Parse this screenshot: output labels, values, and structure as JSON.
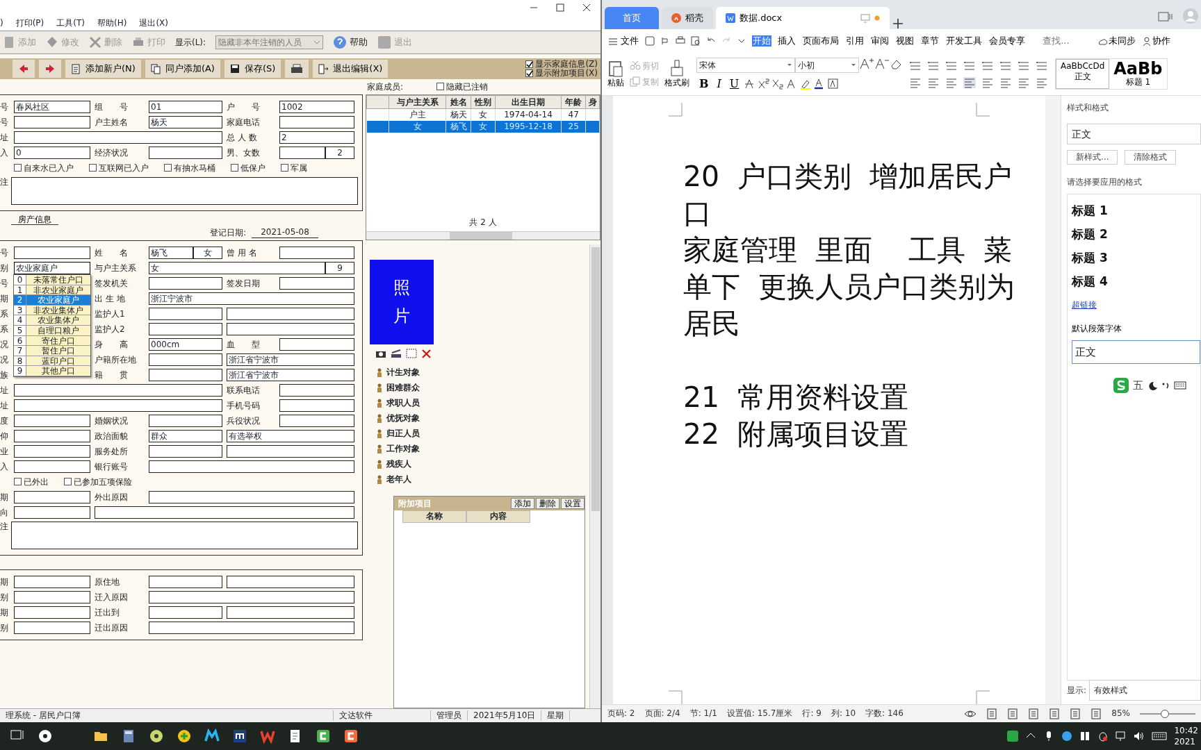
{
  "app": {
    "menu": [
      ")",
      "打印(P)",
      "工具(T)",
      "帮助(H)",
      "退出(X)"
    ],
    "toolbar": [
      {
        "kind": "button",
        "label": "添加",
        "disabled": true
      },
      {
        "kind": "button",
        "label": "修改",
        "disabled": true
      },
      {
        "kind": "button",
        "label": "删除",
        "disabled": true
      },
      {
        "kind": "button",
        "label": "打印",
        "disabled": true
      },
      {
        "kind": "select",
        "label": "显示(L):",
        "value": "隐藏非本年注销的人员",
        "disabled": true
      },
      {
        "kind": "button",
        "label": "帮助",
        "disabled": false
      },
      {
        "kind": "button",
        "label": "退出",
        "disabled": true
      }
    ],
    "edit_buttons": [
      "添加新户(N)",
      "同户添加(A)",
      "保存(S)",
      "退出编辑(X)"
    ],
    "edit_options": [
      {
        "label": "显示家庭信息(Z)",
        "checked": true
      },
      {
        "label": "显示附加项目(X)",
        "checked": true
      }
    ],
    "household": [
      {
        "kind": "fields",
        "cells": [
          {
            "kind": "label",
            "text": "号"
          },
          {
            "kind": "field",
            "value": "春风社区"
          },
          {
            "kind": "label",
            "text": "组　　号"
          },
          {
            "kind": "field",
            "value": "01"
          },
          {
            "kind": "label",
            "text": "户　　号"
          },
          {
            "kind": "field",
            "value": "1002"
          }
        ]
      },
      {
        "kind": "fields",
        "cells": [
          {
            "kind": "label",
            "text": "号"
          },
          {
            "kind": "field"
          },
          {
            "kind": "label",
            "text": "户主姓名"
          },
          {
            "kind": "field",
            "value": "杨天"
          },
          {
            "kind": "label",
            "text": "家庭电话"
          },
          {
            "kind": "field"
          }
        ]
      },
      {
        "kind": "fields",
        "cells": [
          {
            "kind": "label",
            "text": "址"
          },
          {
            "kind": "field",
            "wide": true
          },
          {
            "kind": "label",
            "text": "总 人 数"
          },
          {
            "kind": "field",
            "value": "2"
          }
        ]
      },
      {
        "kind": "fields",
        "cells": [
          {
            "kind": "label",
            "text": "入"
          },
          {
            "kind": "field",
            "value": "0"
          },
          {
            "kind": "label",
            "text": "经济状况"
          },
          {
            "kind": "field"
          },
          {
            "kind": "label",
            "text": "男、女数"
          },
          {
            "kind": "pair",
            "parts": [
              {
                "kind": "field"
              },
              {
                "kind": "field",
                "value": "2"
              }
            ]
          }
        ]
      },
      {
        "kind": "checks",
        "items": [
          {
            "label": "自来水已入户",
            "checked": false
          },
          {
            "label": "互联网已入户",
            "checked": false
          },
          {
            "label": "有抽水马桶",
            "checked": false
          },
          {
            "label": "低保户",
            "checked": false
          },
          {
            "label": "军属",
            "checked": false
          }
        ]
      },
      {
        "kind": "memo",
        "label": "注"
      }
    ],
    "tabs": [
      {
        "label": "房产信息",
        "selected": false
      }
    ],
    "family": {
      "title": "家庭成员:",
      "hide_option": {
        "label": "隐藏已注销",
        "checked": false
      },
      "columns": [
        "与户主关系",
        "姓名",
        "性别",
        "出生日期",
        "年龄",
        "身"
      ],
      "rows": [
        {
          "cells": [
            "户主",
            "杨天",
            "女",
            "1974-04-14",
            "47"
          ],
          "selected": false
        },
        {
          "cells": [
            "女",
            "杨飞",
            "女",
            "1995-12-18",
            "25"
          ],
          "selected": true
        }
      ],
      "footer": "共 2 人"
    },
    "date_label": "登记日期:",
    "date": "2021-05-08",
    "person": [
      {
        "kind": "fields",
        "cells": [
          {
            "kind": "label",
            "text": "号"
          },
          {
            "kind": "field"
          },
          {
            "kind": "label",
            "text": "姓　　名"
          },
          {
            "kind": "pair",
            "parts": [
              {
                "kind": "field",
                "value": "杨飞"
              },
              {
                "kind": "field",
                "value": "女"
              }
            ]
          },
          {
            "kind": "label",
            "text": "曾 用 名"
          },
          {
            "kind": "field"
          }
        ]
      },
      {
        "kind": "fields",
        "cells": [
          {
            "kind": "label",
            "text": "别"
          },
          {
            "kind": "combo",
            "value": "农业家庭户",
            "expanded": true,
            "options": [
              {
                "code": "0",
                "label": "未落常住户口",
                "selected": false
              },
              {
                "code": "1",
                "label": "非农业家庭户",
                "selected": false
              },
              {
                "code": "2",
                "label": "农业家庭户",
                "selected": true
              },
              {
                "code": "3",
                "label": "非农业集体户",
                "selected": false
              },
              {
                "code": "4",
                "label": "农业集体户",
                "selected": false
              },
              {
                "code": "5",
                "label": "自理口粮户",
                "selected": false
              },
              {
                "code": "6",
                "label": "寄住户口",
                "selected": false
              },
              {
                "code": "7",
                "label": "暂住户口",
                "selected": false
              },
              {
                "code": "8",
                "label": "蓝印户口",
                "selected": false
              },
              {
                "code": "9",
                "label": "其他户口",
                "selected": false
              }
            ]
          },
          {
            "kind": "label",
            "text": "与户主关系"
          },
          {
            "kind": "pair",
            "wide": true,
            "parts": [
              {
                "kind": "field",
                "value": "女"
              },
              {
                "kind": "field",
                "value": "9"
              }
            ]
          }
        ]
      },
      {
        "kind": "fields",
        "cells": [
          {
            "kind": "label",
            "text": "号"
          },
          {
            "kind": "covered"
          },
          {
            "kind": "label",
            "text": "签发机关"
          },
          {
            "kind": "field"
          },
          {
            "kind": "label",
            "text": "签发日期"
          },
          {
            "kind": "field"
          }
        ]
      },
      {
        "kind": "fields",
        "cells": [
          {
            "kind": "label",
            "text": "期"
          },
          {
            "kind": "covered"
          },
          {
            "kind": "label",
            "text": "出 生 地"
          },
          {
            "kind": "field",
            "wide": true,
            "value": "浙江宁波市"
          }
        ]
      },
      {
        "kind": "fields",
        "cells": [
          {
            "kind": "label",
            "text": "系"
          },
          {
            "kind": "covered"
          },
          {
            "kind": "label",
            "text": "监护人1"
          },
          {
            "kind": "field"
          },
          {
            "kind": "field",
            "wide": true
          }
        ]
      },
      {
        "kind": "fields",
        "cells": [
          {
            "kind": "label",
            "text": "系"
          },
          {
            "kind": "covered"
          },
          {
            "kind": "label",
            "text": "监护人2"
          },
          {
            "kind": "field"
          },
          {
            "kind": "field",
            "wide": true
          }
        ]
      },
      {
        "kind": "fields",
        "cells": [
          {
            "kind": "label",
            "text": "况"
          },
          {
            "kind": "covered"
          },
          {
            "kind": "label",
            "text": "身　　高"
          },
          {
            "kind": "field",
            "value": "000cm"
          },
          {
            "kind": "label",
            "text": "血　　型"
          },
          {
            "kind": "field"
          }
        ]
      },
      {
        "kind": "fields",
        "cells": [
          {
            "kind": "label",
            "text": "况"
          },
          {
            "kind": "covered"
          },
          {
            "kind": "label",
            "text": "户籍所在地"
          },
          {
            "kind": "field"
          },
          {
            "kind": "field",
            "wide": true,
            "value": "浙江省宁波市"
          }
        ]
      },
      {
        "kind": "fields",
        "cells": [
          {
            "kind": "label",
            "text": "族"
          },
          {
            "kind": "covered"
          },
          {
            "kind": "label",
            "text": "籍　　贯"
          },
          {
            "kind": "field"
          },
          {
            "kind": "field",
            "wide": true,
            "value": "浙江省宁波市"
          }
        ]
      },
      {
        "kind": "fields",
        "cells": [
          {
            "kind": "label",
            "text": "址"
          },
          {
            "kind": "field",
            "wide": true
          },
          {
            "kind": "label",
            "text": "联系电话"
          },
          {
            "kind": "field"
          }
        ]
      },
      {
        "kind": "fields",
        "cells": [
          {
            "kind": "label",
            "text": "址"
          },
          {
            "kind": "field",
            "wide": true
          },
          {
            "kind": "label",
            "text": "手机号码"
          },
          {
            "kind": "field"
          }
        ]
      },
      {
        "kind": "fields",
        "cells": [
          {
            "kind": "label",
            "text": "度"
          },
          {
            "kind": "field"
          },
          {
            "kind": "label",
            "text": "婚姻状况"
          },
          {
            "kind": "field"
          },
          {
            "kind": "label",
            "text": "兵役状况"
          },
          {
            "kind": "field"
          }
        ]
      },
      {
        "kind": "fields",
        "cells": [
          {
            "kind": "label",
            "text": "仰"
          },
          {
            "kind": "field"
          },
          {
            "kind": "label",
            "text": "政治面貌"
          },
          {
            "kind": "field",
            "value": "群众"
          },
          {
            "kind": "field",
            "wide": true,
            "value": "有选举权"
          }
        ]
      },
      {
        "kind": "fields",
        "cells": [
          {
            "kind": "label",
            "text": "业"
          },
          {
            "kind": "field"
          },
          {
            "kind": "label",
            "text": "服务处所"
          },
          {
            "kind": "field"
          },
          {
            "kind": "field",
            "wide": true
          }
        ]
      },
      {
        "kind": "fields",
        "cells": [
          {
            "kind": "label",
            "text": "入"
          },
          {
            "kind": "field"
          },
          {
            "kind": "label",
            "text": "银行账号"
          },
          {
            "kind": "field",
            "wide": true
          }
        ]
      },
      {
        "kind": "checks",
        "items": [
          {
            "label": "已外出",
            "checked": false
          },
          {
            "label": "已参加五项保险",
            "checked": false
          }
        ]
      },
      {
        "kind": "fields",
        "cells": [
          {
            "kind": "label",
            "text": "期"
          },
          {
            "kind": "field"
          },
          {
            "kind": "label",
            "text": "外出原因"
          },
          {
            "kind": "field",
            "wide": true
          }
        ]
      },
      {
        "kind": "fields",
        "cells": [
          {
            "kind": "label",
            "text": "向"
          },
          {
            "kind": "field"
          },
          {
            "kind": "field",
            "wide": true
          }
        ]
      },
      {
        "kind": "memo",
        "label": "注"
      }
    ],
    "migration": [
      {
        "kind": "fields",
        "cells": [
          {
            "kind": "label",
            "text": "期"
          },
          {
            "kind": "field"
          },
          {
            "kind": "label",
            "text": "原住地"
          },
          {
            "kind": "field"
          },
          {
            "kind": "field",
            "wide": true
          }
        ]
      },
      {
        "kind": "fields",
        "cells": [
          {
            "kind": "label",
            "text": "别"
          },
          {
            "kind": "field"
          },
          {
            "kind": "label",
            "text": "迁入原因"
          },
          {
            "kind": "field",
            "wide": true
          }
        ]
      },
      {
        "kind": "fields",
        "cells": [
          {
            "kind": "label",
            "text": "期"
          },
          {
            "kind": "field"
          },
          {
            "kind": "label",
            "text": "迁出到"
          },
          {
            "kind": "field"
          },
          {
            "kind": "field",
            "wide": true
          }
        ]
      },
      {
        "kind": "fields",
        "cells": [
          {
            "kind": "label",
            "text": "别"
          },
          {
            "kind": "field"
          },
          {
            "kind": "label",
            "text": "迁出原因"
          },
          {
            "kind": "field",
            "wide": true
          }
        ]
      }
    ],
    "photo": "照片",
    "categories": [
      "计生对象",
      "困难群众",
      "求职人员",
      "优抚对象",
      "归正人员",
      "工作对象",
      "残疾人",
      "老年人"
    ],
    "extra": {
      "title": "附加项目",
      "buttons": [
        "添加",
        "删除",
        "设置"
      ],
      "columns": [
        "名称",
        "内容"
      ]
    },
    "status": [
      "理系统 - 居民户口簿",
      "文达软件",
      "管理员",
      "2021年5月10日",
      "星期"
    ]
  },
  "wps": {
    "tabs": [
      {
        "kind": "home",
        "label": "首页",
        "selected": false
      },
      {
        "kind": "app",
        "label": "稻壳",
        "selected": false
      },
      {
        "kind": "doc",
        "label": "数据.docx",
        "selected": true
      }
    ],
    "file_menu": "文件",
    "ribbon_tabs": [
      {
        "label": "开始",
        "selected": true
      },
      {
        "label": "插入",
        "selected": false
      },
      {
        "label": "页面布局",
        "selected": false
      },
      {
        "label": "引用",
        "selected": false
      },
      {
        "label": "审阅",
        "selected": false
      },
      {
        "label": "视图",
        "selected": false
      },
      {
        "label": "章节",
        "selected": false
      },
      {
        "label": "开发工具",
        "selected": false
      },
      {
        "label": "会员专享",
        "selected": false
      }
    ],
    "search": {
      "placeholder": "查找..."
    },
    "sync": "未同步",
    "collab": "协作",
    "clipboard": [
      {
        "label": "粘贴",
        "disabled": false
      },
      {
        "label": "剪切",
        "disabled": true
      },
      {
        "label": "复制",
        "disabled": true
      },
      {
        "label": "格式刷",
        "disabled": false
      }
    ],
    "font": "宋体",
    "size": "小初",
    "format_glyphs": [
      "B",
      "I",
      "U"
    ],
    "styles": [
      {
        "sample": "AaBbCcDd",
        "label": "正文",
        "selected": true
      },
      {
        "sample": "AaBb",
        "label": "标题 1",
        "selected": false
      }
    ],
    "blocks": [
      [
        "20  户口类别  增加居民户口",
        "家庭管理  里面    工具  菜单下  更换人员户口类别为居民"
      ],
      [
        "21  常用资料设置",
        "22  附属项目设置"
      ]
    ],
    "panel": {
      "title": "样式和格式",
      "current": "正文",
      "buttons": [
        "新样式...",
        "清除格式"
      ],
      "prompt": "请选择要应用的格式",
      "styles": [
        {
          "kind": "heading",
          "label": "标题 1",
          "selected": false
        },
        {
          "kind": "heading",
          "label": "标题 2",
          "selected": false
        },
        {
          "kind": "heading",
          "label": "标题 3",
          "selected": false
        },
        {
          "kind": "heading",
          "label": "标题 4",
          "selected": false
        },
        {
          "kind": "link",
          "label": "超链接",
          "selected": false
        },
        {
          "kind": "plain",
          "label": "默认段落字体",
          "selected": false
        },
        {
          "kind": "plain",
          "label": "正文",
          "selected": true
        }
      ],
      "show_label": "显示:",
      "show_value": "有效样式"
    },
    "ime": "五",
    "status": [
      "页码: 2",
      "页面: 2/4",
      "节: 1/1",
      "设置值: 15.7厘米",
      "行: 9",
      "列: 10",
      "字数: 146"
    ],
    "zoom": "85%",
    "zoom_slider": {
      "level": 0.45
    }
  },
  "taskbar": {
    "time": "10:42",
    "date": "2021"
  }
}
